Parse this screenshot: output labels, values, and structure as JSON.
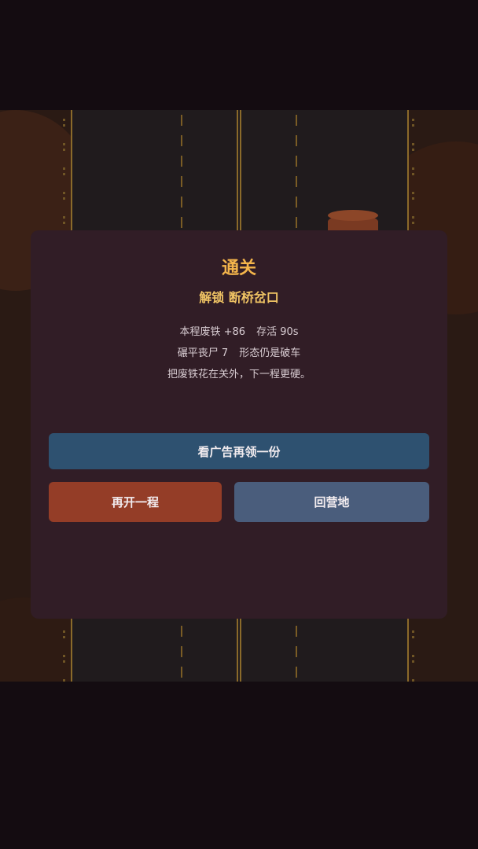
{
  "modal": {
    "title": "通关",
    "unlock_text": "解锁 断桥岔口",
    "stats": {
      "scrap_label": "本程废铁 +86",
      "survive_label": "存活 90s",
      "zombies_label": "碾平丧尸 7",
      "form_label": "形态仍是破车"
    },
    "tip": "把废铁花在关外，下一程更硬。"
  },
  "buttons": {
    "ad_label": "看广告再领一份",
    "restart_label": "再开一程",
    "camp_label": "回营地"
  },
  "colors": {
    "title": "#f4b54b",
    "unlock": "#f0c464",
    "modal_bg": "#311d26",
    "ad_button": "#2e5170",
    "restart_button": "#943d27",
    "camp_button": "#4a5d7c"
  }
}
